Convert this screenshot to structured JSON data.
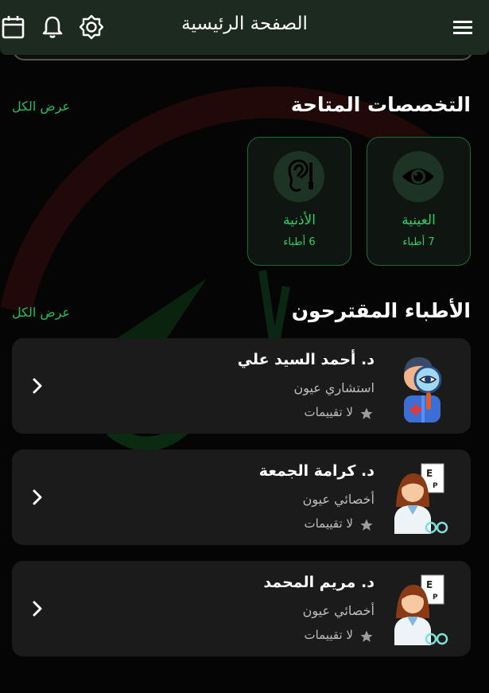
{
  "header": {
    "title": "الصفحة الرئيسية"
  },
  "specialties": {
    "title": "التخصصات المتاحة",
    "view_all": "عرض الكل",
    "items": [
      {
        "name": "العينية",
        "count": "7 أطباء",
        "icon": "eye-icon"
      },
      {
        "name": "الأذنية",
        "count": "6 أطباء",
        "icon": "ear-icon"
      }
    ]
  },
  "doctors": {
    "title": "الأطباء المقترحون",
    "view_all": "عرض الكل",
    "items": [
      {
        "name": "د. أحمد السيد علي",
        "specialty": "استشاري عيون",
        "rating": "لا تقييمات",
        "avatar": "male-eye-doctor-avatar"
      },
      {
        "name": "د. كرامة الجمعة",
        "specialty": "أخصائي عيون",
        "rating": "لا تقييمات",
        "avatar": "female-optometrist-avatar"
      },
      {
        "name": "د. مريم المحمد",
        "specialty": "أخصائي عيون",
        "rating": "لا تقييمات",
        "avatar": "female-optometrist-avatar"
      }
    ]
  },
  "colors": {
    "accent": "#1fc05a",
    "appbar": "#1c2a1f",
    "background": "#050505",
    "card": "#1b1b1b"
  }
}
